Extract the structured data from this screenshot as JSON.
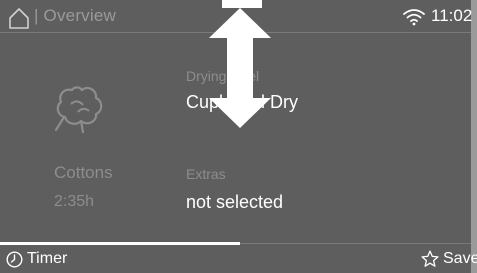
{
  "header": {
    "home_icon": "home-icon",
    "title": "Overview",
    "wifi_icon": "wifi-icon",
    "time": "11:02"
  },
  "program": {
    "icon": "cotton-icon",
    "name": "Cottons",
    "duration": "2:35h"
  },
  "settings": {
    "drying_level_label": "Drying level",
    "drying_level_value": "Cupboard Dry",
    "extras_label": "Extras",
    "extras_value": "not selected"
  },
  "overlay": {
    "icon": "double-arrow-vertical-icon"
  },
  "progress": {
    "fraction": 0.51
  },
  "footer": {
    "timer_label": "Timer",
    "timer_icon": "clock-icon",
    "save_label": "Save",
    "save_icon": "star-icon"
  },
  "colors": {
    "background": "#5e5e5e",
    "dim_text": "#8d8d8d",
    "text": "#ffffff"
  }
}
